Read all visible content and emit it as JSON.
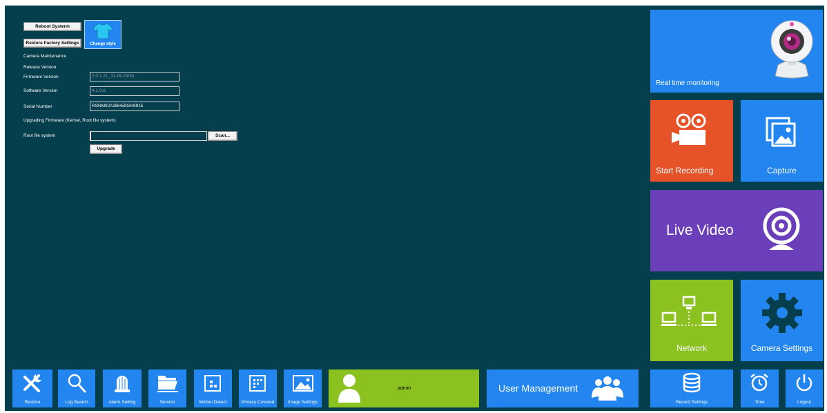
{
  "colors": {
    "background": "#053f4e",
    "tile_blue": "#2285f0",
    "tile_orange": "#e75329",
    "tile_purple": "#6b3fb9",
    "tile_green": "#8bc220"
  },
  "system": {
    "reboot_label": "Reboot Systerm",
    "restore_factory_label": "Restore Factory Settings",
    "change_style_label": "Change style",
    "change_style_icon": "tshirt-icon"
  },
  "maintenance": {
    "section_title": "Camera Maintenance",
    "release_title": "Release Version",
    "firmware_label": "Firmware Version",
    "firmware_value": "2.0.1.21_31-IR-GPIO",
    "software_label": "Software Version",
    "software_value": "4.1.0.6",
    "serial_label": "Serial Number",
    "serial_value": "RSNM9JA3BH59GH8915",
    "upgrade_title": "Upgrading Firmware (Kernel, Root file system)",
    "rootfs_label": "Root file system",
    "rootfs_value": "",
    "scan_label": "Scan...",
    "upgrade_label": "Upgrade"
  },
  "tiles": {
    "realtime": {
      "label": "Real time monitoring",
      "icon": "webcam-icon"
    },
    "recording": {
      "label": "Start Recording",
      "icon": "video-camera-icon"
    },
    "capture": {
      "label": "Capture",
      "icon": "photo-gallery-icon"
    },
    "live": {
      "label": "Live Video",
      "icon": "webcam-icon"
    },
    "network": {
      "label": "Network",
      "icon": "network-icon"
    },
    "camera_settings": {
      "label": "Camera Settings",
      "icon": "gear-icon"
    }
  },
  "bottom_bar": {
    "restore": "Restore",
    "log_search": "Log Search",
    "alarm_setting": "Alarm Setting",
    "service": "Service",
    "motion_detect": "Motion Detect",
    "privacy_covered": "Privacy Covered",
    "image_settings": "Image Settings",
    "user_name": "admin",
    "user_management": "User Management",
    "record_settings": "Record Settings",
    "time": "Time",
    "logout": "Logout"
  }
}
